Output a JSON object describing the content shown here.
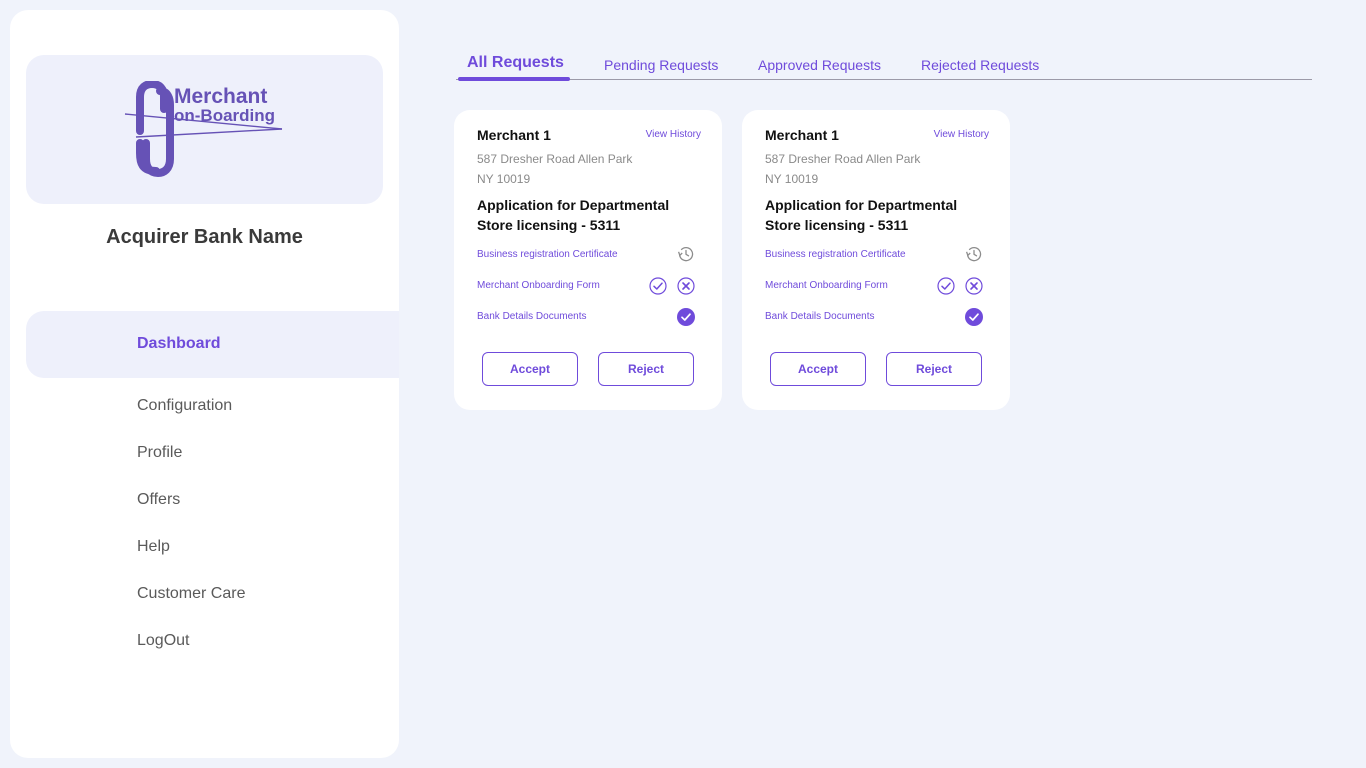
{
  "sidebar": {
    "logo_line1": "Merchant",
    "logo_line2": "on-Boarding",
    "bank_name": "Acquirer Bank Name",
    "nav": [
      {
        "label": "Dashboard"
      },
      {
        "label": "Configuration"
      },
      {
        "label": "Profile"
      },
      {
        "label": "Offers"
      },
      {
        "label": "Help"
      },
      {
        "label": "Customer Care"
      },
      {
        "label": "LogOut"
      }
    ]
  },
  "tabs": [
    {
      "label": "All Requests"
    },
    {
      "label": "Pending Requests"
    },
    {
      "label": "Approved Requests"
    },
    {
      "label": "Rejected Requests"
    }
  ],
  "cards": [
    {
      "merchant": "Merchant 1",
      "view_history": "View History",
      "address_line1": "587 Dresher Road Allen Park",
      "address_line2": "NY 10019",
      "application": "Application for Departmental Store licensing - 5311",
      "documents": [
        {
          "label": "Business registration Certificate",
          "status": "pending"
        },
        {
          "label": "Merchant Onboarding Form",
          "status": "review"
        },
        {
          "label": "Bank Details Documents",
          "status": "approved"
        }
      ],
      "accept_label": "Accept",
      "reject_label": "Reject"
    },
    {
      "merchant": "Merchant 1",
      "view_history": "View History",
      "address_line1": "587 Dresher Road Allen Park",
      "address_line2": "NY 10019",
      "application": "Application for Departmental Store licensing - 5311",
      "documents": [
        {
          "label": "Business registration Certificate",
          "status": "pending"
        },
        {
          "label": "Merchant Onboarding Form",
          "status": "review"
        },
        {
          "label": "Bank Details Documents",
          "status": "approved"
        }
      ],
      "accept_label": "Accept",
      "reject_label": "Reject"
    }
  ],
  "colors": {
    "accent": "#6f4bdb",
    "background": "#f0f3fb",
    "panel": "#ffffff",
    "highlight": "#eef0fb"
  },
  "icons": {
    "pending": "history-icon",
    "approve": "check-circle-icon",
    "reject": "x-circle-icon",
    "approved": "check-filled-icon"
  }
}
